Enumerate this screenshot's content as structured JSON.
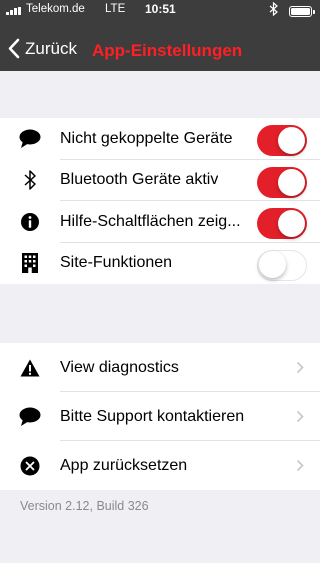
{
  "status_bar": {
    "carrier": "Telekom.de",
    "network": "LTE",
    "time": "10:51"
  },
  "nav": {
    "back_label": "Zurück",
    "title": "App-Einstellungen"
  },
  "settings": [
    {
      "label": "Nicht gekoppelte Geräte",
      "icon": "speech-bubble-icon",
      "enabled": true
    },
    {
      "label": "Bluetooth Geräte aktiv",
      "icon": "bluetooth-icon",
      "enabled": true
    },
    {
      "label": "Hilfe-Schaltflächen zeig...",
      "icon": "info-icon",
      "enabled": true
    },
    {
      "label": "Site-Funktionen",
      "icon": "building-icon",
      "enabled": false
    }
  ],
  "actions": [
    {
      "label": "View diagnostics",
      "icon": "warning-icon"
    },
    {
      "label": "Bitte Support kontaktieren",
      "icon": "speech-bubble-icon"
    },
    {
      "label": "App zurücksetzen",
      "icon": "close-circle-icon"
    }
  ],
  "footer": {
    "version": "Version 2.12, Build 326"
  },
  "colors": {
    "nav_background": "#3d3d3d",
    "title": "#ff1f25",
    "toggle_on": "#e3202a",
    "page_background": "#efeff4"
  }
}
